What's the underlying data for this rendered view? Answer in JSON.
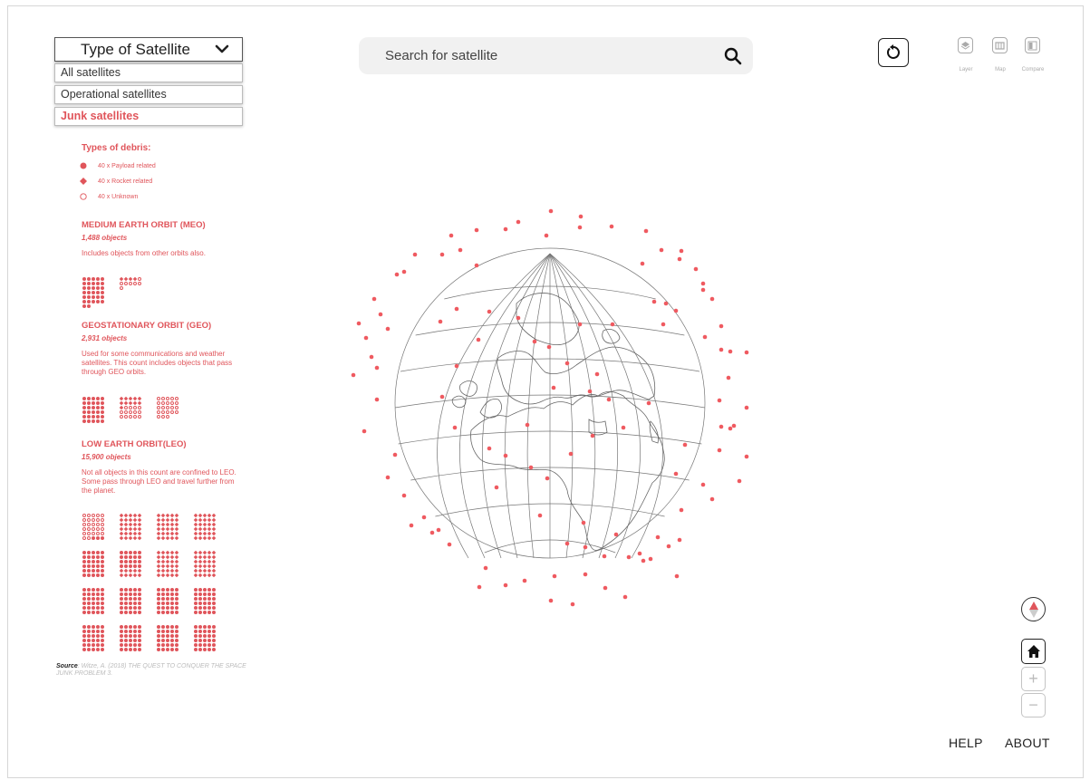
{
  "filter": {
    "selected_label": "Type of Satellite",
    "options": [
      {
        "label": "All satellites",
        "active": false
      },
      {
        "label": "Operational satellites",
        "active": false
      },
      {
        "label": "Junk satellites",
        "active": true
      }
    ]
  },
  "debris": {
    "title": "Types of debris:",
    "legend": [
      {
        "marker": "filled-circle",
        "label": "40 x Payload related"
      },
      {
        "marker": "diamond",
        "label": "40 x Rocket related"
      },
      {
        "marker": "open-circle",
        "label": "40 x Unknown"
      }
    ]
  },
  "orbits": [
    {
      "title": "MEDIUM EARTH ORBIT (MEO)",
      "count": "1,488 objects",
      "description": "Includes objects from other orbits also."
    },
    {
      "title": "GEOSTATIONARY ORBIT (GEO)",
      "count": "2,931 objects",
      "description": "Used for some communications and weather satellites. This count includes objects that pass through GEO orbits."
    },
    {
      "title": "LOW EARTH ORBIT(LEO)",
      "count": "15,900 objects",
      "description": "Not all objects in this count are confined to LEO. Some pass through LEO and travel further from the planet."
    }
  ],
  "source": {
    "label": "Source",
    "text": ": Witze, A. (2018) THE QUEST TO CONQUER THE SPACE JUNK PROBLEM 3."
  },
  "search": {
    "placeholder": "Search for satellite"
  },
  "tools": [
    {
      "label": "Layer",
      "icon": "layers-icon"
    },
    {
      "label": "Map",
      "icon": "map-icon"
    },
    {
      "label": "Compare",
      "icon": "compare-icon"
    }
  ],
  "zoom": {
    "in_label": "+",
    "out_label": "−"
  },
  "footer": {
    "help": "HELP",
    "about": "ABOUT"
  },
  "colors": {
    "accent": "#e0555b",
    "text": "#222222",
    "muted": "#aaaaaa"
  }
}
